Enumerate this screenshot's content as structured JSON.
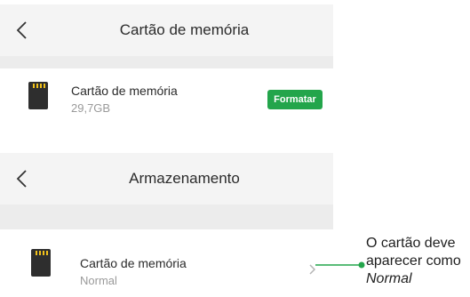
{
  "screen1": {
    "title": "Cartão de memória",
    "card": {
      "name": "Cartão de memória",
      "capacity": "29,7GB",
      "format_label": "Formatar"
    }
  },
  "screen2": {
    "title": "Armazenamento",
    "card": {
      "name": "Cartão de memória",
      "status": "Normal"
    }
  },
  "annotation": {
    "line1": "O cartão deve",
    "line2": "aparecer como",
    "line3": "Normal"
  },
  "colors": {
    "accent": "#23a54b",
    "header_bg": "#f4f4f4",
    "separator": "#ececec"
  },
  "icons": [
    "back-chevron-icon",
    "sd-card-icon",
    "chevron-right-icon"
  ]
}
